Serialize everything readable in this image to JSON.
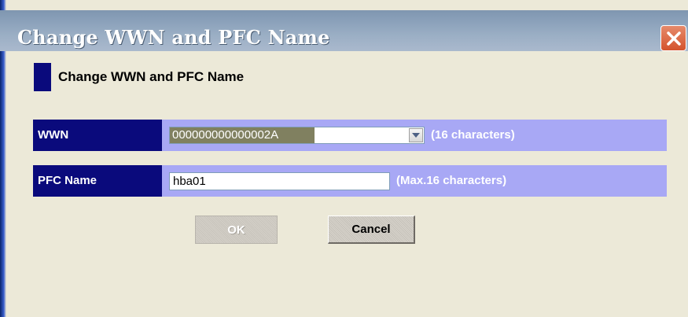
{
  "window": {
    "title": "Change WWN and PFC Name"
  },
  "heading": {
    "text": "Change WWN and PFC Name"
  },
  "wwn_row": {
    "label": "WWN",
    "value": "000000000000002A",
    "hint": "(16 characters)"
  },
  "pfc_row": {
    "label": "PFC Name",
    "value": "hba01",
    "hint": "(Max.16 characters)"
  },
  "buttons": {
    "ok_label": "OK",
    "cancel_label": "Cancel"
  },
  "icons": {
    "close": "close-icon",
    "dropdown": "chevron-down-icon"
  },
  "colors": {
    "label_bg": "#0a0a7c",
    "row_bg": "#a8a8f5",
    "close_button": "#d4532d",
    "titlebar": "#8ca2bb"
  }
}
